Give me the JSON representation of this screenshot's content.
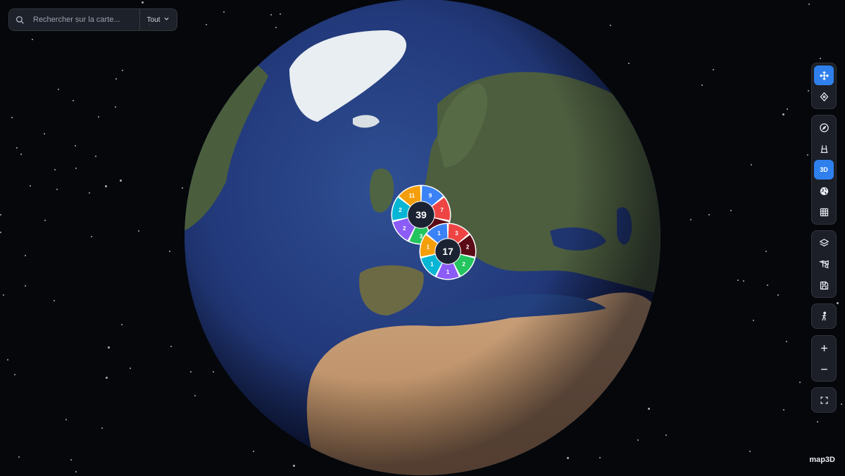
{
  "search": {
    "placeholder": "Rechercher sur la carte...",
    "filter_label": "Tout"
  },
  "toolbar": {
    "groups": [
      [
        {
          "name": "pan-tool-button",
          "icon": "move-icon",
          "active": true
        },
        {
          "name": "orbit-tool-button",
          "icon": "orbit-icon",
          "active": false
        }
      ],
      [
        {
          "name": "compass-button",
          "icon": "compass-icon",
          "active": false
        },
        {
          "name": "perspective-button",
          "icon": "perspective-icon",
          "active": false
        },
        {
          "name": "view-3d-button",
          "icon": "3d-icon",
          "label": "3D",
          "active": true
        },
        {
          "name": "globe-view-button",
          "icon": "globe-icon",
          "active": false
        },
        {
          "name": "grid-view-button",
          "icon": "grid-icon",
          "active": false
        }
      ],
      [
        {
          "name": "layers-button",
          "icon": "layers-icon",
          "active": false
        },
        {
          "name": "map-search-button",
          "icon": "map-search-icon",
          "active": false
        },
        {
          "name": "save-button",
          "icon": "save-icon",
          "active": false
        }
      ],
      [
        {
          "name": "street-view-button",
          "icon": "pedestrian-icon",
          "active": false
        }
      ],
      [
        {
          "name": "zoom-in-button",
          "icon": "plus-icon",
          "active": false
        },
        {
          "name": "zoom-out-button",
          "icon": "minus-icon",
          "active": false
        }
      ],
      [
        {
          "name": "fullscreen-button",
          "icon": "fullscreen-icon",
          "active": false
        }
      ]
    ]
  },
  "clusters": [
    {
      "id": "cluster-39",
      "total": "39",
      "segments": [
        {
          "color": "#3b82f6",
          "label": "9"
        },
        {
          "color": "#ef4444",
          "label": "7"
        },
        {
          "color": "#5b0b16",
          "label": "5"
        },
        {
          "color": "#22c55e",
          "label": "3"
        },
        {
          "color": "#8b5cf6",
          "label": "2"
        },
        {
          "color": "#06b6d4",
          "label": "2"
        },
        {
          "color": "#f59e0b",
          "label": "11"
        }
      ]
    },
    {
      "id": "cluster-17",
      "total": "17",
      "segments": [
        {
          "color": "#ef4444",
          "label": "3"
        },
        {
          "color": "#5b0b16",
          "label": "2"
        },
        {
          "color": "#22c55e",
          "label": "2"
        },
        {
          "color": "#8b5cf6",
          "label": "1"
        },
        {
          "color": "#06b6d4",
          "label": "1"
        },
        {
          "color": "#f59e0b",
          "label": "1"
        },
        {
          "color": "#3b82f6",
          "label": "1"
        }
      ]
    }
  ],
  "brand": {
    "wordmark": "map3D"
  }
}
